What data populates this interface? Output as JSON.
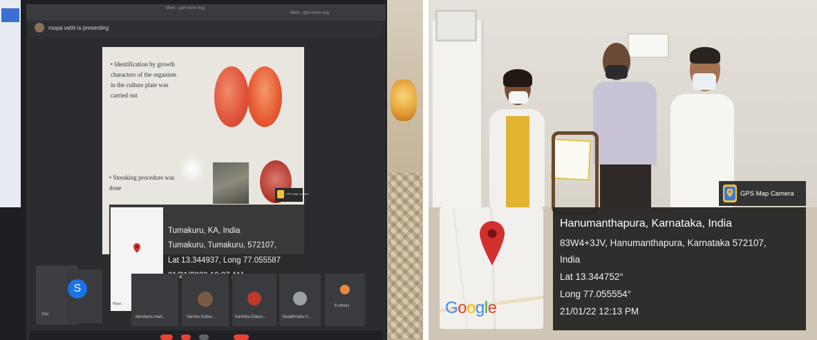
{
  "left_photo": {
    "meet_tab_1": "Meet - gsm-wnrv-ksg",
    "meet_tab_2": "Meet - gsm-wnrv-ksg",
    "presenter_banner": "roopa vathi is presenting",
    "slide_bullet_1": "• Identification by growth characters of the organism in the culture plate was carried out",
    "slide_bullet_2": "• Streaking procedure was done",
    "participants": [
      "You",
      "darshana mad...",
      "Varsha Subra...",
      "Karthika Edass...",
      "Swadhinata H...",
      "8 others"
    ],
    "participant_initial": "S",
    "geotag": {
      "line1": "Tumakuru, KA, India",
      "line2": "Tumakuru, Tumakuru, 572107,",
      "line3": "Lat 13.344937, Long 77.055587",
      "line4": "01/21/2022 10:37 AM"
    },
    "map_brand_small": "Maps",
    "stamp_small": "GPS Map Camera"
  },
  "right_photo": {
    "brand_label": "GPS Map Camera",
    "map_logo": "Google",
    "geotag": {
      "line1": "Hanumanthapura, Karnataka, India",
      "line2": "83W4+3JV, Hanumanthapura, Karnataka 572107,",
      "line3": "India",
      "line4": "Lat 13.344752°",
      "line5": "Long 77.055554°",
      "line6": "21/01/22 12:13 PM"
    }
  },
  "colors": {
    "map_pin": "#d32f2f",
    "google_blue": "#4285f4",
    "google_red": "#ea4335",
    "google_yellow": "#fbbc05",
    "google_green": "#34a853",
    "overlay_dark": "#2a2a2a"
  }
}
